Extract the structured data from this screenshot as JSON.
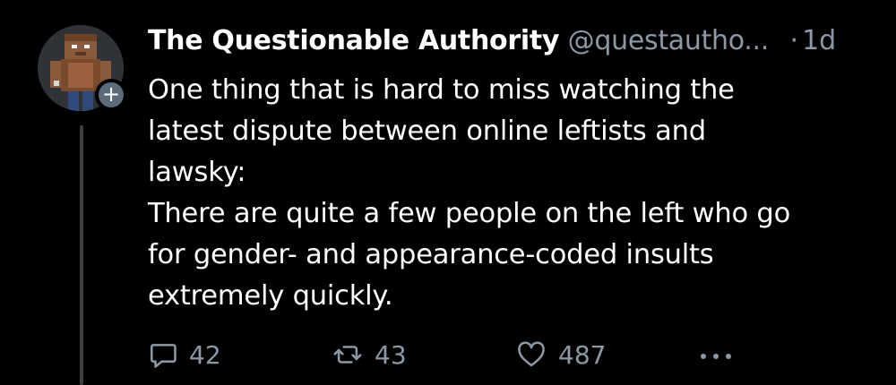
{
  "tweet": {
    "author": {
      "display_name": "The Questionable Authority",
      "handle": "@questautho...",
      "avatar_icon": "minecraft-character-avatar",
      "follow_badge": "+"
    },
    "separator": "·",
    "timestamp": "1d",
    "text": "One thing that is hard to miss watching the\nlatest dispute between online leftists and\nlawsky:\nThere are quite a few people on the left who go\nfor gender- and appearance-coded insults\nextremely quickly.",
    "actions": {
      "reply_icon": "reply-icon",
      "reply_count": "42",
      "retweet_icon": "retweet-icon",
      "retweet_count": "43",
      "like_icon": "heart-icon",
      "like_count": "487",
      "more_icon": "more-icon"
    }
  },
  "colors": {
    "background": "#000000",
    "primary_text": "#ffffff",
    "secondary_text": "#8b98a5",
    "thread_line": "#3e4144"
  }
}
